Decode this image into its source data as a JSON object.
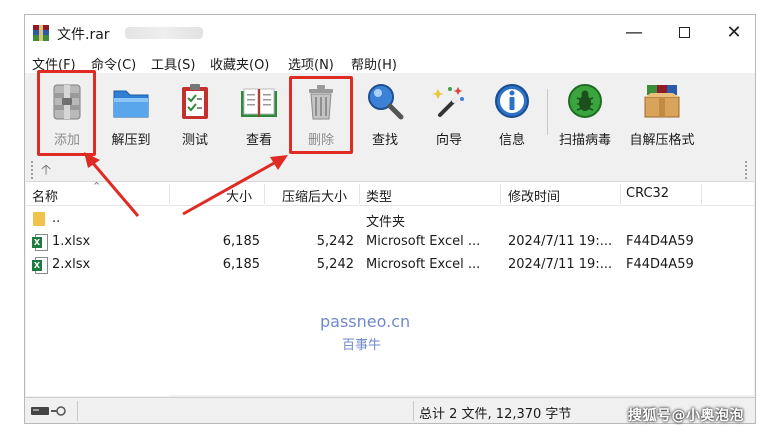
{
  "window": {
    "title": "文件.rar"
  },
  "menu": [
    "文件(F)",
    "命令(C)",
    "工具(S)",
    "收藏夹(O)",
    "选项(N)",
    "帮助(H)"
  ],
  "toolbar": {
    "add": "添加",
    "extract": "解压到",
    "test": "测试",
    "view": "查看",
    "delete": "删除",
    "find": "查找",
    "wizard": "向导",
    "info": "信息",
    "scan": "扫描病毒",
    "sfx": "自解压格式"
  },
  "columns": {
    "name": "名称",
    "size": "大小",
    "packed": "压缩后大小",
    "type": "类型",
    "modified": "修改时间",
    "crc": "CRC32"
  },
  "rows": [
    {
      "name": "..",
      "size": "",
      "packed": "",
      "type": "文件夹",
      "modified": "",
      "crc": ""
    },
    {
      "name": "1.xlsx",
      "size": "6,185",
      "packed": "5,242",
      "type": "Microsoft Excel ...",
      "modified": "2024/7/11 19:...",
      "crc": "F44D4A59"
    },
    {
      "name": "2.xlsx",
      "size": "6,185",
      "packed": "5,242",
      "type": "Microsoft Excel ...",
      "modified": "2024/7/11 19:...",
      "crc": "F44D4A59"
    }
  ],
  "watermark": {
    "line1": "passneo.cn",
    "line2": "百事牛"
  },
  "status": {
    "summary": "总计 2 文件, 12,370 字节"
  },
  "corner_watermark": "搜狐号@小奥泡泡",
  "colors": {
    "highlight": "#e02a24"
  }
}
